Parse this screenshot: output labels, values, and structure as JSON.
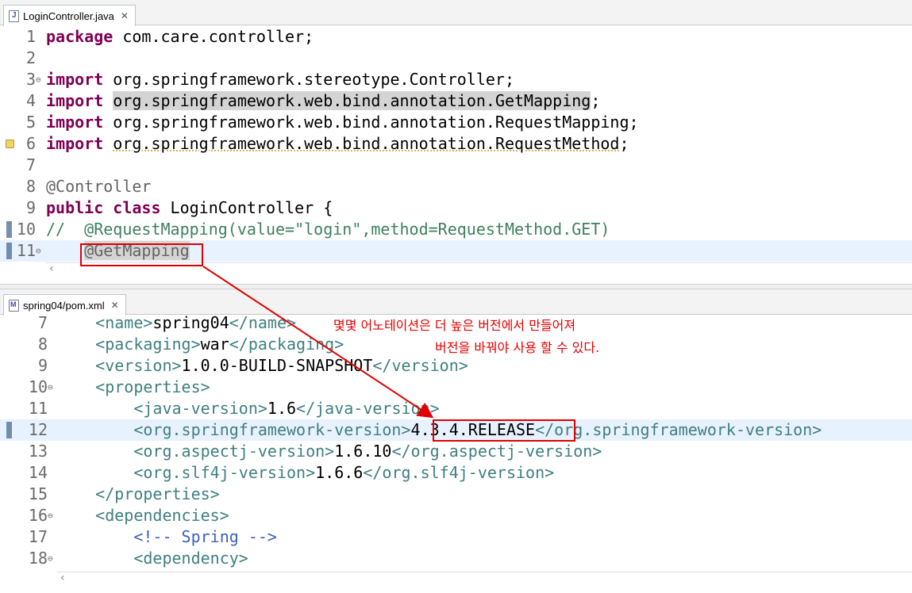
{
  "top_editor": {
    "tab_label": "LoginController.java",
    "lines": [
      {
        "n": "1",
        "segs": [
          {
            "t": "package",
            "c": "kw"
          },
          {
            "t": " com.care.controller;",
            "c": ""
          }
        ]
      },
      {
        "n": "2",
        "segs": []
      },
      {
        "n": "3",
        "fold": true,
        "segs": [
          {
            "t": "import",
            "c": "kw"
          },
          {
            "t": " org.springframework.stereotype.Controller;",
            "c": ""
          }
        ]
      },
      {
        "n": "4",
        "segs": [
          {
            "t": "import",
            "c": "kw"
          },
          {
            "t": " ",
            "c": ""
          },
          {
            "t": "org.springframework.web.bind.annotation.GetMapping",
            "c": "hl"
          },
          {
            "t": ";",
            "c": ""
          }
        ]
      },
      {
        "n": "5",
        "segs": [
          {
            "t": "import",
            "c": "kw"
          },
          {
            "t": " org.springframework.web.bind.annotation.RequestMapping;",
            "c": ""
          }
        ]
      },
      {
        "n": "6",
        "warning": true,
        "segs": [
          {
            "t": "import",
            "c": "kw"
          },
          {
            "t": " ",
            "c": ""
          },
          {
            "t": "org.springframework.web.bind.annotation.RequestMethod",
            "c": "warn"
          },
          {
            "t": ";",
            "c": ""
          }
        ]
      },
      {
        "n": "7",
        "segs": []
      },
      {
        "n": "8",
        "segs": [
          {
            "t": "@Controller",
            "c": "ann"
          }
        ]
      },
      {
        "n": "9",
        "segs": [
          {
            "t": "public",
            "c": "kw"
          },
          {
            "t": " ",
            "c": ""
          },
          {
            "t": "class",
            "c": "kw"
          },
          {
            "t": " LoginController {",
            "c": ""
          }
        ]
      },
      {
        "n": "10",
        "marker": true,
        "segs": [
          {
            "t": "//  @RequestMapping(value=\"login\",method=RequestMethod.GET)",
            "c": "cmt"
          }
        ]
      },
      {
        "n": "11",
        "marker": true,
        "fold": true,
        "current": true,
        "segs": [
          {
            "t": "    ",
            "c": ""
          },
          {
            "t": "@GetMapping",
            "c": "ann hl"
          }
        ]
      }
    ]
  },
  "bottom_editor": {
    "tab_label": "spring04/pom.xml",
    "lines": [
      {
        "n": "7",
        "segs": [
          {
            "t": "    <name>",
            "c": "tagc"
          },
          {
            "t": "spring04",
            "c": ""
          },
          {
            "t": "</name>",
            "c": "tagc"
          }
        ]
      },
      {
        "n": "8",
        "segs": [
          {
            "t": "    <packaging>",
            "c": "tagc"
          },
          {
            "t": "war",
            "c": ""
          },
          {
            "t": "</packaging>",
            "c": "tagc"
          }
        ]
      },
      {
        "n": "9",
        "segs": [
          {
            "t": "    <version>",
            "c": "tagc"
          },
          {
            "t": "1.0.0-BUILD-SNAPSHOT",
            "c": ""
          },
          {
            "t": "</version>",
            "c": "tagc"
          }
        ]
      },
      {
        "n": "10",
        "fold": true,
        "segs": [
          {
            "t": "    <properties>",
            "c": "tagc"
          }
        ]
      },
      {
        "n": "11",
        "segs": [
          {
            "t": "        <java-version>",
            "c": "tagc"
          },
          {
            "t": "1.6",
            "c": ""
          },
          {
            "t": "</java-version>",
            "c": "tagc"
          }
        ]
      },
      {
        "n": "12",
        "marker": true,
        "current": true,
        "segs": [
          {
            "t": "        <org.springframework-version>",
            "c": "tagc"
          },
          {
            "t": "4.3.4.RELEASE",
            "c": ""
          },
          {
            "t": "</org.springframework-version>",
            "c": "tagc"
          }
        ]
      },
      {
        "n": "13",
        "segs": [
          {
            "t": "        <org.aspectj-version>",
            "c": "tagc"
          },
          {
            "t": "1.6.10",
            "c": ""
          },
          {
            "t": "</org.aspectj-version>",
            "c": "tagc"
          }
        ]
      },
      {
        "n": "14",
        "segs": [
          {
            "t": "        <org.slf4j-version>",
            "c": "tagc"
          },
          {
            "t": "1.6.6",
            "c": ""
          },
          {
            "t": "</org.slf4j-version>",
            "c": "tagc"
          }
        ]
      },
      {
        "n": "15",
        "segs": [
          {
            "t": "    </properties>",
            "c": "tagc"
          }
        ]
      },
      {
        "n": "16",
        "fold": true,
        "segs": [
          {
            "t": "    <dependencies>",
            "c": "tagc"
          }
        ]
      },
      {
        "n": "17",
        "segs": [
          {
            "t": "        ",
            "c": ""
          },
          {
            "t": "<!-- Spring -->",
            "c": "xmlcmt"
          }
        ]
      },
      {
        "n": "18",
        "fold": true,
        "segs": [
          {
            "t": "        <dependency>",
            "c": "tagc"
          }
        ]
      }
    ]
  },
  "annotation_note": {
    "line1": "몇몇 어노테이션은 더 높은 버전에서 만들어져",
    "line2": "버전을 바꿔야 사용 할 수 있다."
  },
  "colors": {
    "accent_red": "#e00000",
    "current_line": "#e8f2fe",
    "keyword": "#7f0055",
    "xml_tag": "#3f7f7f"
  }
}
